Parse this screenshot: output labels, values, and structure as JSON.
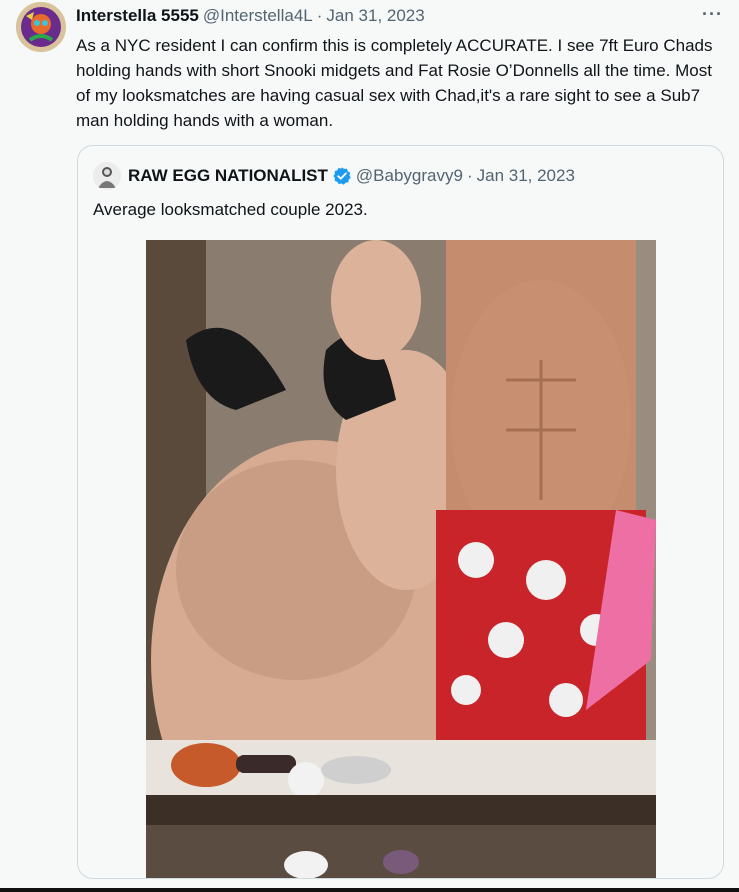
{
  "tweet": {
    "author_name": "Interstella 5555",
    "author_handle": "@Interstella4L",
    "separator": "·",
    "date": "Jan 31, 2023",
    "more_label": "···",
    "body": "As a NYC resident I can confirm this is completely ACCURATE. I see 7ft Euro Chads holding hands with short Snooki midgets and Fat Rosie O’Donnells all the time. Most of my looksmatches are having casual sex with Chad,it's a rare sight to see a Sub7 man holding hands with a woman."
  },
  "quoted_tweet": {
    "author_name": "RAW EGG NATIONALIST",
    "author_handle": "@Babygravy9",
    "separator": "·",
    "date": "Jan 31, 2023",
    "body": "Average looksmatched couple 2023.",
    "verified_icon": "verified-badge-icon",
    "verified_color": "#1d9bf0"
  },
  "colors": {
    "text_primary": "#0f1419",
    "text_secondary": "#536471",
    "border": "#cfd9de",
    "background": "#f7f9f9"
  }
}
